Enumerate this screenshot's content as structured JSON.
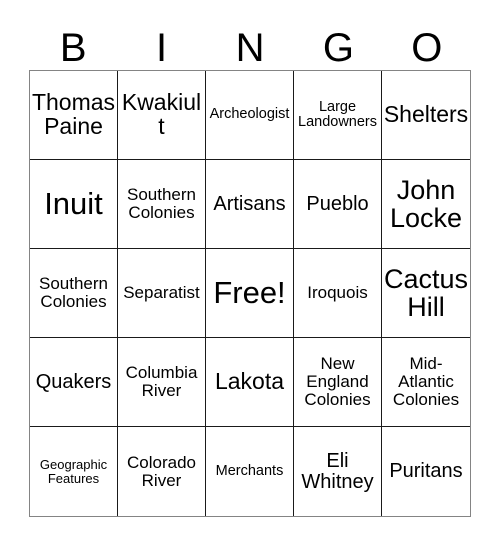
{
  "card": {
    "title": "Bingo Card",
    "header_letters": [
      "B",
      "I",
      "N",
      "G",
      "O"
    ],
    "colors": {
      "background": "#ffffff",
      "text": "#000000",
      "inner_border": "#1a1a1a",
      "outer_border": "#848484"
    },
    "free_space": "Free!",
    "rows": [
      [
        {
          "label": "Thomas Paine",
          "size": "l"
        },
        {
          "label": "Kwakiult",
          "size": "l"
        },
        {
          "label": "Archeologist",
          "size": "xs"
        },
        {
          "label": "Large Landowners",
          "size": "xs"
        },
        {
          "label": "Shelters",
          "size": "l"
        }
      ],
      [
        {
          "label": "Inuit",
          "size": "xxl"
        },
        {
          "label": "Southern Colonies",
          "size": "s"
        },
        {
          "label": "Artisans",
          "size": "m"
        },
        {
          "label": "Pueblo",
          "size": "m"
        },
        {
          "label": "John Locke",
          "size": "xl"
        }
      ],
      [
        {
          "label": "Southern Colonies",
          "size": "s"
        },
        {
          "label": "Separatist",
          "size": "s"
        },
        {
          "label": "Free!",
          "size": "xxl"
        },
        {
          "label": "Iroquois",
          "size": "s"
        },
        {
          "label": "Cactus Hill",
          "size": "xl"
        }
      ],
      [
        {
          "label": "Quakers",
          "size": "m"
        },
        {
          "label": "Columbia River",
          "size": "s"
        },
        {
          "label": "Lakota",
          "size": "l"
        },
        {
          "label": "New England Colonies",
          "size": "s"
        },
        {
          "label": "Mid-Atlantic Colonies",
          "size": "s"
        }
      ],
      [
        {
          "label": "Geographic Features",
          "size": "xxs"
        },
        {
          "label": "Colorado River",
          "size": "s"
        },
        {
          "label": "Merchants",
          "size": "xs"
        },
        {
          "label": "Eli Whitney",
          "size": "m"
        },
        {
          "label": "Puritans",
          "size": "m"
        }
      ]
    ]
  }
}
